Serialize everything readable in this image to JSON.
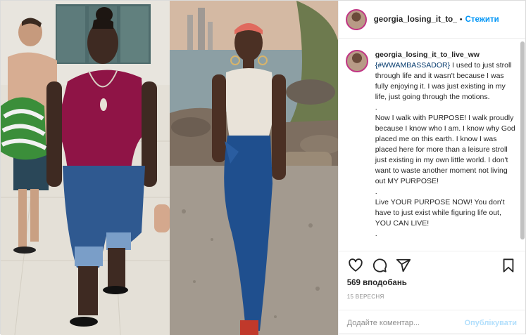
{
  "post": {
    "username": "georgia_losing_it_to_live_ww",
    "header_username": "georgia_losing_it_to_livi",
    "separator": "•",
    "follow_label": "Стежити",
    "caption": {
      "hashtag": "{#WWAMBASSADOR}",
      "body": " I used to just stroll through life and it wasn't because I was fully enjoying it. I was just existing in my life, just going through the motions.\n.\nNow I walk with PURPOSE! I walk proudly because I know who I am. I know why God placed me on this earth. I know I was placed here for more than a leisure stroll just existing in my own little world. I don't want to waste another moment not living out MY PURPOSE!\n.\nLive YOUR PURPOSE NOW! You don't have to just exist while figuring life out, YOU CAN LIVE!\n."
    },
    "likes": "569 вподобань",
    "date": "15 ВЕРЕСНЯ",
    "comment_placeholder": "Додайте коментар...",
    "publish_label": "Опублікувати"
  },
  "icons": [
    "heart-icon",
    "comment-icon",
    "share-icon",
    "bookmark-icon"
  ],
  "colors": {
    "link_blue": "#0095f6",
    "hashtag_blue": "#00376b",
    "muted_gray": "#8e8e8e",
    "publish_disabled": "#b2dffc",
    "story_ring": "#c13584"
  }
}
